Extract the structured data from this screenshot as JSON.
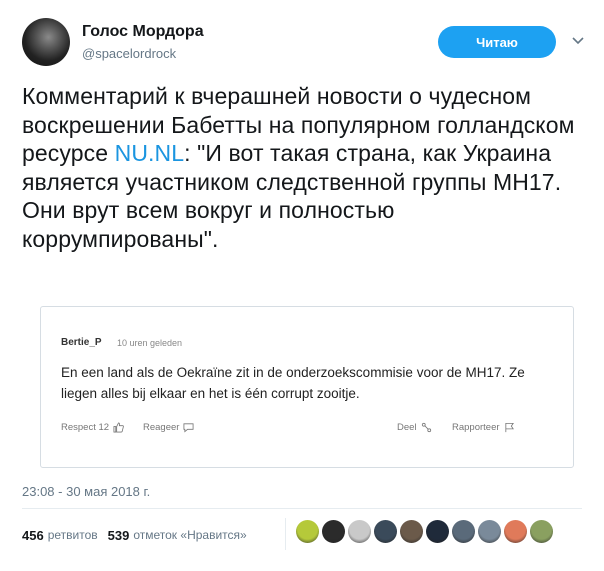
{
  "header": {
    "display_name": "Голос Мордора",
    "handle": "@spacelordrock",
    "follow_button": "Читаю"
  },
  "tweet": {
    "text_before_link": "Комментарий к вчерашней новости о чудесном воскрешении Бабетты на популярном голландском ресурсе ",
    "link": "NU.NL",
    "text_after_link": ": \"И вот такая страна, как Украина является участником следственной группы МН17. Они врут всем вокруг и полностью коррумпированы\"."
  },
  "quote": {
    "author": "Bertie_P",
    "time": "10 uren geleden",
    "text": "En een land als de Oekraïne zit in de onderzoekscommisie voor de MH17. Ze liegen alles bij elkaar en het is één corrupt zooitje.",
    "respect_label": "Respect 12",
    "reply_label": "Reageer",
    "share_label": "Deel",
    "report_label": "Rapporteer"
  },
  "timestamp": "23:08 - 30 мая 2018 г.",
  "stats": {
    "retweets_count": "456",
    "retweets_label": "ретвитов",
    "likes_count": "539",
    "likes_label": "отметок «Нравится»"
  },
  "likers": [
    {
      "color": "#b5c93a"
    },
    {
      "color": "#2b2b2b"
    },
    {
      "color": "#c9c9c9"
    },
    {
      "color": "#3a4a5a"
    },
    {
      "color": "#6b5a4a"
    },
    {
      "color": "#1f2a3a"
    },
    {
      "color": "#5a6a7a"
    },
    {
      "color": "#7a8a9a"
    },
    {
      "color": "#e07a5a"
    },
    {
      "color": "#8aa060"
    }
  ],
  "colors": {
    "accent": "#1da1f2",
    "link": "#1b95e0"
  }
}
